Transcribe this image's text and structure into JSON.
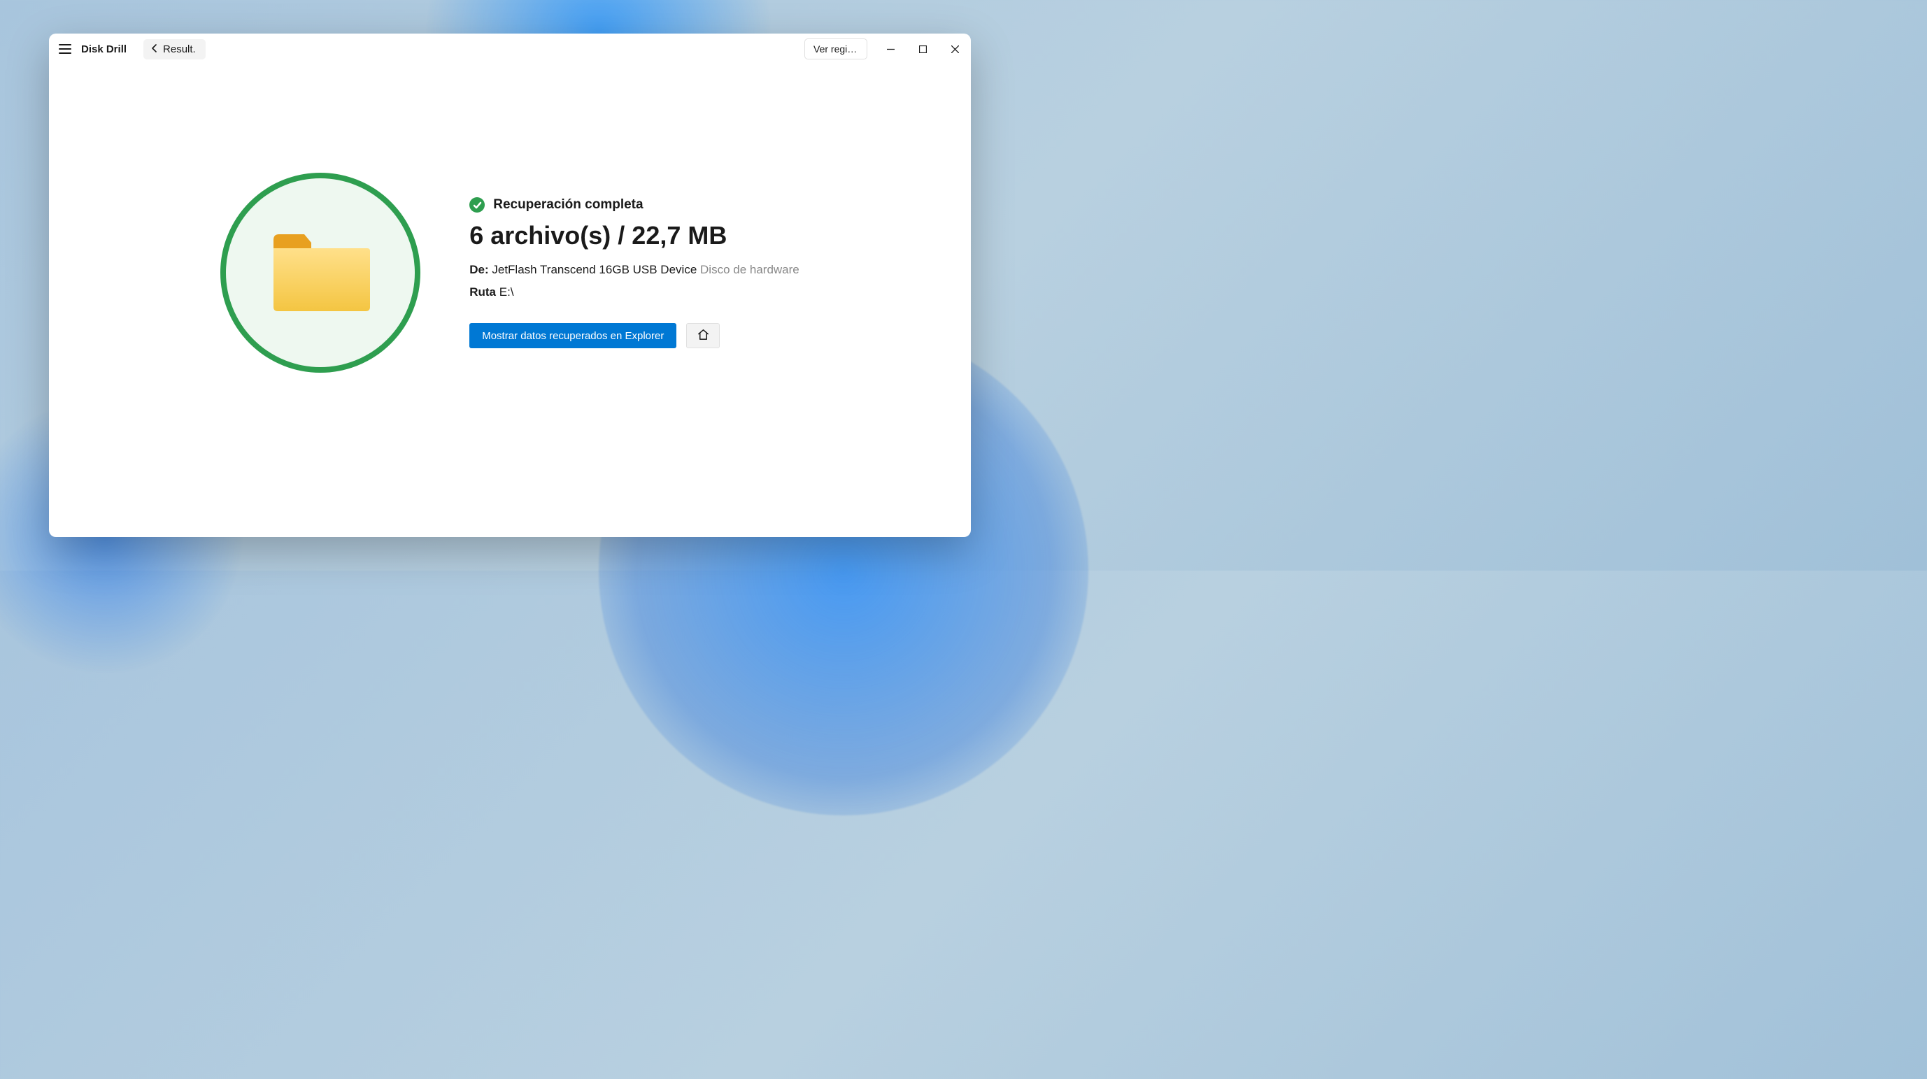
{
  "titlebar": {
    "app_name": "Disk Drill",
    "back_label": "Result.",
    "log_button_label": "Ver regis..."
  },
  "result": {
    "status_label": "Recuperación completa",
    "summary": "6 archivo(s) / 22,7 MB",
    "from_label": "De:",
    "from_device": "JetFlash Transcend 16GB USB Device",
    "from_type": "Disco de hardware",
    "path_label": "Ruta",
    "path_value": "E:\\",
    "show_button_label": "Mostrar datos recuperados en Explorer"
  },
  "colors": {
    "success": "#2e9e4f",
    "primary": "#0078d4"
  }
}
